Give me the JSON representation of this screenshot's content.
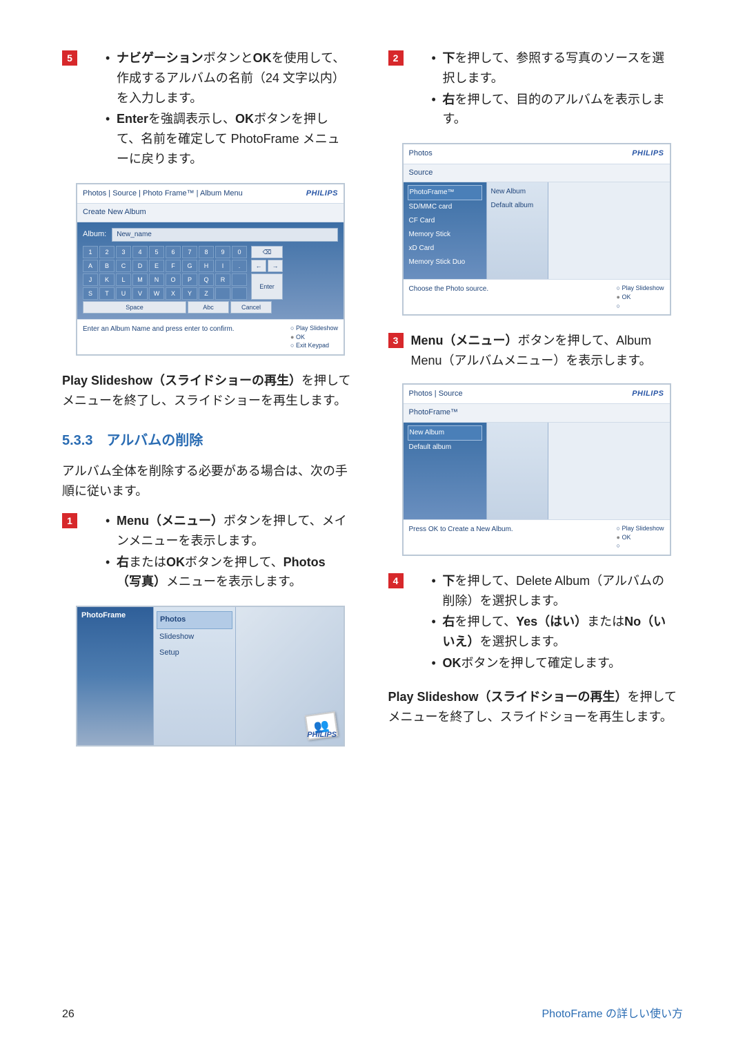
{
  "brand": "PHILIPS",
  "left_col": {
    "step5": {
      "num": "5",
      "bullets": [
        {
          "pre": "ナビゲーション",
          "mid": "ボタンと",
          "b2": "OK",
          "post": "を使用して、作成するアルバムの名前（24 文字以内）を入力します。"
        },
        {
          "pre": "Enter",
          "mid": "を強調表示し、",
          "b2": "OK",
          "post": "ボタンを押して、名前を確定して PhotoFrame メニューに戻ります。"
        }
      ]
    },
    "ss_keypad": {
      "breadcrumb": "Photos | Source | Photo Frame™ | Album Menu",
      "title": "Create New Album",
      "album_label": "Album:",
      "album_value": "New_name",
      "rows": [
        [
          "1",
          "2",
          "3",
          "4",
          "5",
          "6",
          "7",
          "8",
          "9",
          "0"
        ],
        [
          "A",
          "B",
          "C",
          "D",
          "E",
          "F",
          "G",
          "H",
          "I",
          "."
        ],
        [
          "J",
          "K",
          "L",
          "M",
          "N",
          "O",
          "P",
          "Q",
          "R",
          ""
        ],
        [
          "S",
          "T",
          "U",
          "V",
          "W",
          "X",
          "Y",
          "Z",
          "",
          ""
        ]
      ],
      "backspace": "⌫",
      "arrow_l": "←",
      "arrow_r": "→",
      "enter": "Enter",
      "space": "Space",
      "abc": "Abc",
      "cancel": "Cancel",
      "footer": "Enter an Album Name and press enter to confirm.",
      "act1": "Play Slideshow",
      "act2": "OK",
      "act3": "Exit Keypad"
    },
    "play_slideshow_para": {
      "b1": "Play Slideshow（スライドショーの再生）",
      "rest": "を押してメニューを終了し、スライドショーを再生します。"
    },
    "heading": "5.3.3　アルバムの削除",
    "intro": "アルバム全体を削除する必要がある場合は、次の手順に従います。",
    "step1": {
      "num": "1",
      "bullets": [
        {
          "pre": "Menu（メニュー）",
          "post": "ボタンを押して、メインメニューを表示します。"
        },
        {
          "pre": "右",
          "mid": "または",
          "b2": "OK",
          "mid2": "ボタンを押して、",
          "b3": "Photos（写真）",
          "post": "メニューを表示します。"
        }
      ]
    },
    "ss_mainmenu": {
      "title": "PhotoFrame",
      "items": [
        "Photos",
        "Slideshow",
        "Setup"
      ]
    }
  },
  "right_col": {
    "step2": {
      "num": "2",
      "bullets": [
        {
          "pre": "下",
          "post": "を押して、参照する写真のソースを選択します。"
        },
        {
          "pre": "右",
          "post": "を押して、目的のアルバムを表示します。"
        }
      ]
    },
    "ss_source": {
      "breadcrumb": "Photos",
      "sub": "Source",
      "left_items": [
        "PhotoFrame™",
        "SD/MMC card",
        "CF Card",
        "Memory Stick",
        "xD Card",
        "Memory Stick Duo"
      ],
      "mid_items": [
        "New Album",
        "Default album"
      ],
      "footer": "Choose the Photo source.",
      "act1": "Play Slideshow",
      "act2": "OK"
    },
    "step3": {
      "num": "3",
      "text_pre": "Menu（メニュー）",
      "text_post": "ボタンを押して、Album Menu（アルバムメニュー）を表示します。"
    },
    "ss_album": {
      "breadcrumb": "Photos | Source",
      "sub": "PhotoFrame™",
      "left_items": [
        "New Album",
        "Default album"
      ],
      "footer": "Press OK to Create a New Album.",
      "act1": "Play Slideshow",
      "act2": "OK"
    },
    "step4": {
      "num": "4",
      "bullets": [
        {
          "pre": "下",
          "post": "を押して、Delete Album（アルバムの削除）を選択します。"
        },
        {
          "pre": "右",
          "mid": "を押して、",
          "b2": "Yes（はい）",
          "mid2": "または",
          "b3": "No（いいえ）",
          "post": "を選択します。"
        },
        {
          "pre": "OK",
          "post": "ボタンを押して確定します。"
        }
      ]
    },
    "play_slideshow_para": {
      "b1": "Play Slideshow（スライドショーの再生）",
      "rest": "を押してメニューを終了し、スライドショーを再生します。"
    }
  },
  "footer": {
    "page": "26",
    "section": "PhotoFrame の詳しい使い方"
  }
}
